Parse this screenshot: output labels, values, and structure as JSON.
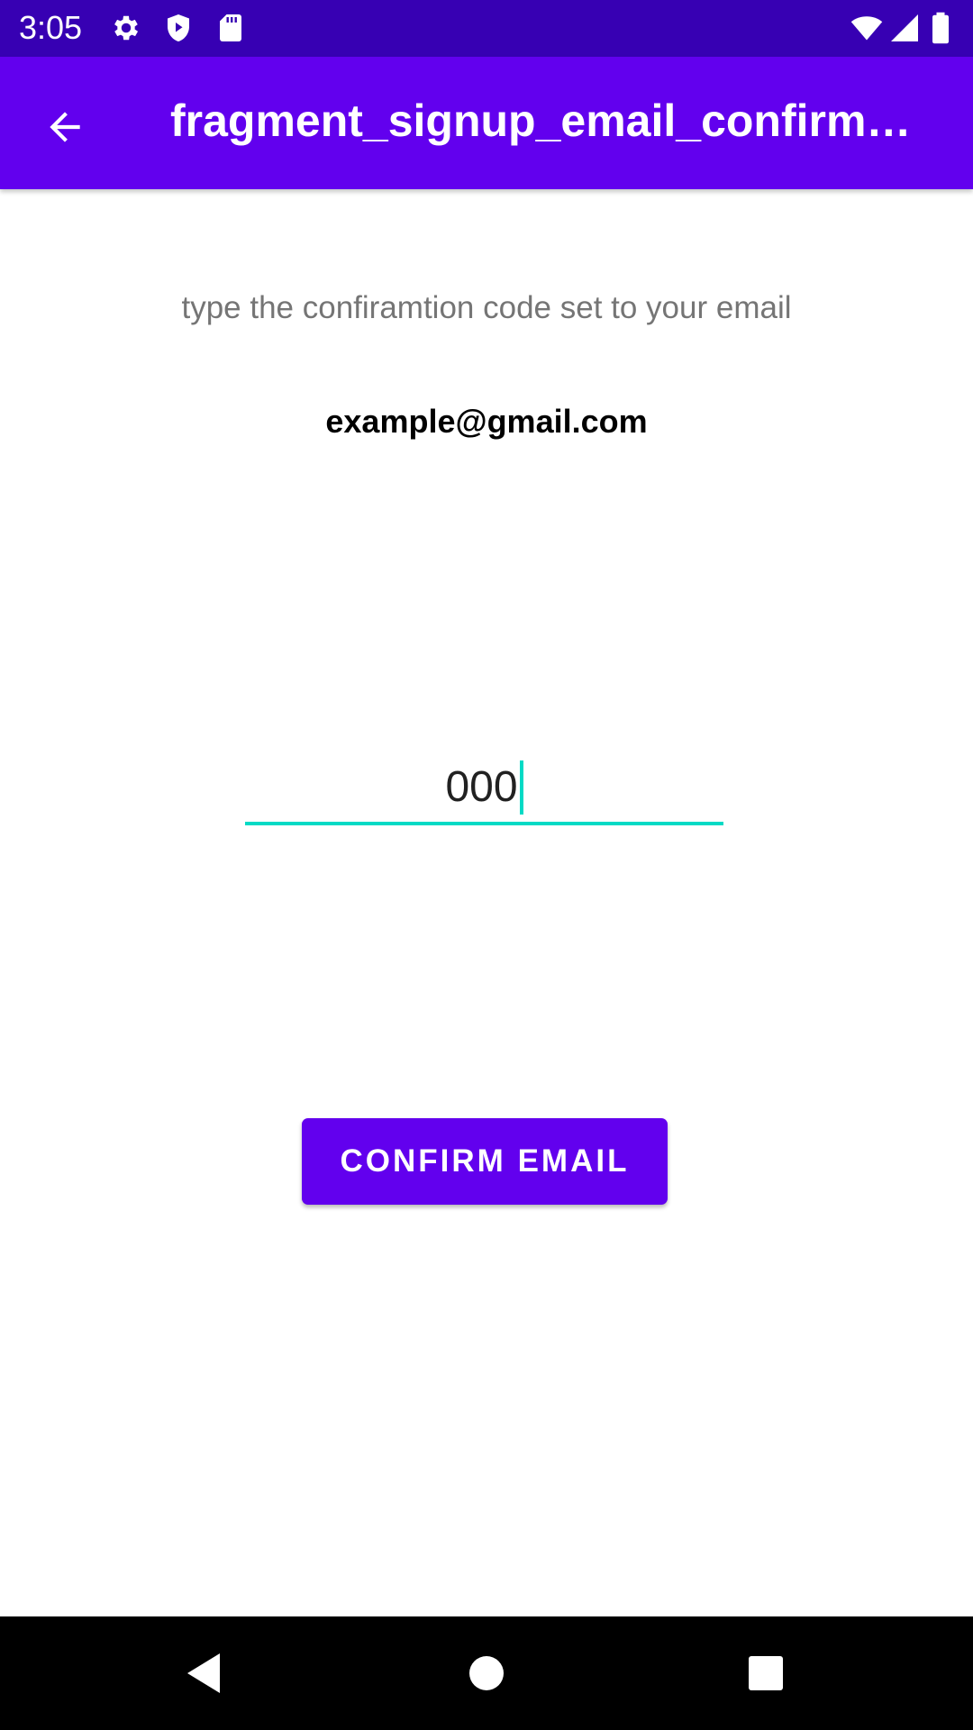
{
  "status_bar": {
    "time": "3:05",
    "left_icons": [
      "gear-icon",
      "shield-icon",
      "sd-card-icon"
    ],
    "right_icons": [
      "wifi-icon",
      "cellular-signal-icon",
      "battery-icon"
    ]
  },
  "app_bar": {
    "back_icon": "arrow-back-icon",
    "title": "fragment_signup_email_confirm…"
  },
  "content": {
    "instruction": "type the confiramtion code set to your email",
    "email": "example@gmail.com",
    "code_value": "000",
    "confirm_label": "CONFIRM EMAIL"
  },
  "nav_bar": {
    "buttons": [
      "back-triangle-icon",
      "home-circle-icon",
      "recents-square-icon"
    ]
  },
  "colors": {
    "status_bar": "#3700b3",
    "primary": "#6200ee",
    "accent": "#03dac5",
    "instruction_text": "#757575",
    "nav_bar": "#000000"
  }
}
